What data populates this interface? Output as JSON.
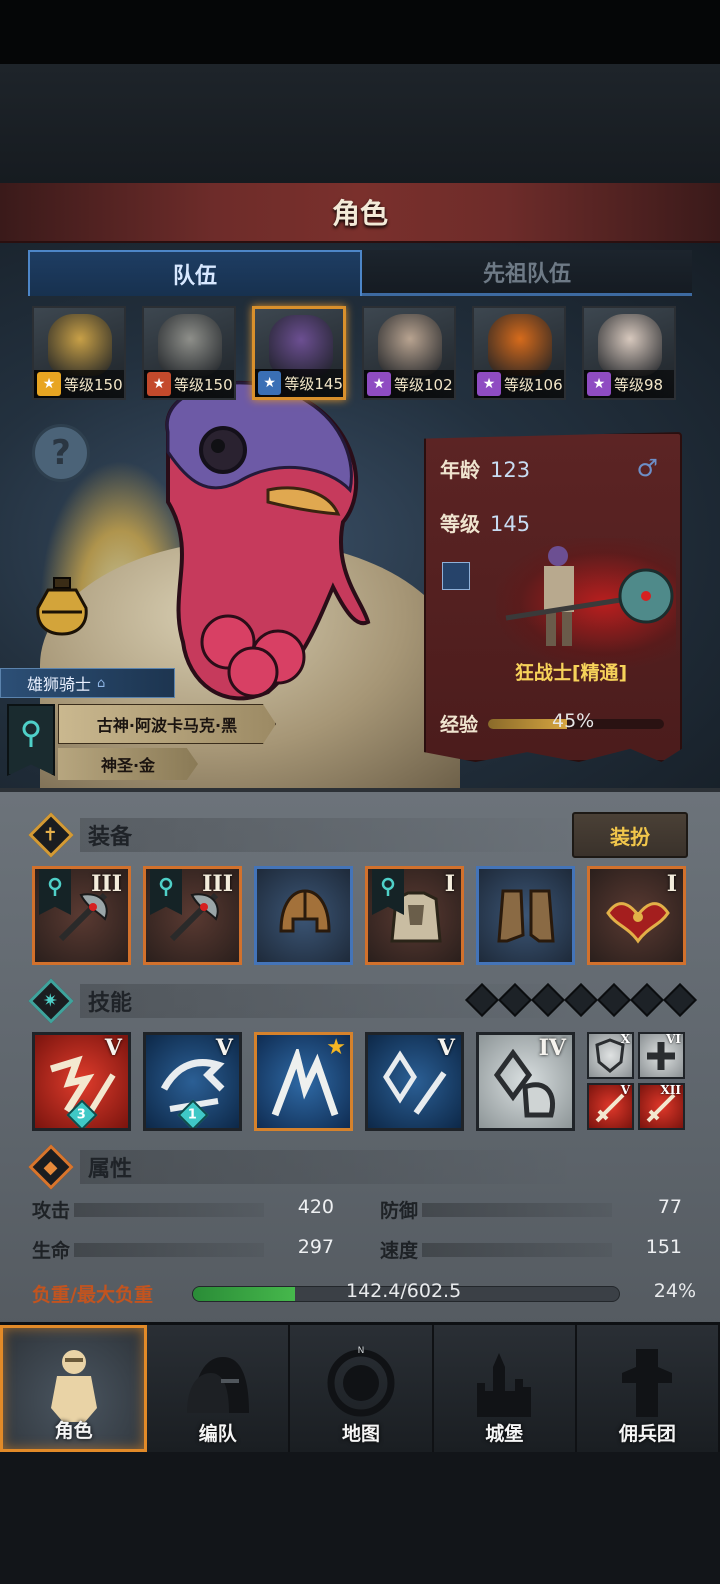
{
  "title": "角色",
  "tabs": [
    {
      "label": "队伍",
      "active": true
    },
    {
      "label": "先祖队伍",
      "active": false
    }
  ],
  "roster": [
    {
      "level_text": "等级150",
      "class_color": "#e8a522",
      "face_color": "#c8a047",
      "selected": false
    },
    {
      "level_text": "等级150",
      "class_color": "#c44a2c",
      "face_color": "#8e8f8a",
      "selected": false
    },
    {
      "level_text": "等级145",
      "class_color": "#3a6fb5",
      "face_color": "#6c4f92",
      "selected": true
    },
    {
      "level_text": "等级102",
      "class_color": "#8f4cc2",
      "face_color": "#b8a390",
      "selected": false
    },
    {
      "level_text": "等级106",
      "class_color": "#8f4cc2",
      "face_color": "#d66b1c",
      "selected": false
    },
    {
      "level_text": "等级98",
      "class_color": "#8f4cc2",
      "face_color": "#d7c8bd",
      "selected": false
    }
  ],
  "faction": {
    "order": "雄狮骑士",
    "deity": "古神·阿波卡马克·黑",
    "alignment": "神圣·金"
  },
  "hero_card": {
    "age_label": "年龄",
    "age": "123",
    "level_label": "等级",
    "level": "145",
    "class_name": "狂战士[精通]",
    "exp_label": "经验",
    "exp_percent_text": "45%",
    "exp_fraction": 0.45
  },
  "equipment": {
    "section_title": "装备",
    "dress_button": "装扮",
    "slots": [
      {
        "rarity": "orange",
        "tier": "III",
        "sigil": true,
        "item_icon": "weapon-axe-icon"
      },
      {
        "rarity": "orange",
        "tier": "III",
        "sigil": true,
        "item_icon": "weapon-axe-icon"
      },
      {
        "rarity": "blue",
        "tier": "",
        "sigil": false,
        "item_icon": "helmet-icon"
      },
      {
        "rarity": "orange",
        "tier": "I",
        "sigil": true,
        "item_icon": "armor-icon"
      },
      {
        "rarity": "blue",
        "tier": "",
        "sigil": false,
        "item_icon": "boots-icon"
      },
      {
        "rarity": "orange",
        "tier": "I",
        "sigil": false,
        "item_icon": "amulet-icon"
      }
    ]
  },
  "skills": {
    "section_title": "技能",
    "gem_slots": 7,
    "items": [
      {
        "style": "red",
        "tier": "V",
        "count": "3",
        "star": false,
        "icon": "sword-slash-icon"
      },
      {
        "style": "dblue",
        "tier": "V",
        "count": "1",
        "star": false,
        "icon": "leap-strike-icon"
      },
      {
        "style": "gold",
        "tier": "",
        "count": "",
        "star": true,
        "icon": "claw-icon"
      },
      {
        "style": "dblue",
        "tier": "V",
        "count": "",
        "star": false,
        "icon": "crystal-sword-icon"
      },
      {
        "style": "white",
        "tier": "IV",
        "count": "",
        "star": false,
        "icon": "crystal-shield-icon"
      }
    ],
    "passives": [
      {
        "style": "w",
        "tier": "X",
        "icon": "shield-icon"
      },
      {
        "style": "w",
        "tier": "VI",
        "icon": "plus-icon"
      },
      {
        "style": "r",
        "tier": "V",
        "icon": "sword-icon"
      },
      {
        "style": "r",
        "tier": "XII",
        "icon": "sword-icon"
      }
    ]
  },
  "attributes": {
    "section_title": "属性",
    "stats": [
      {
        "label": "攻击",
        "value": "420"
      },
      {
        "label": "防御",
        "value": "77"
      },
      {
        "label": "生命",
        "value": "297"
      },
      {
        "label": "速度",
        "value": "151"
      }
    ],
    "load_label": "负重/最大负重",
    "load_text": "142.4/602.5",
    "load_percent": "24%",
    "load_fraction": 0.24
  },
  "nav": [
    {
      "label": "角色",
      "icon": "knight-icon",
      "active": true
    },
    {
      "label": "编队",
      "icon": "helmet-group-icon",
      "active": false
    },
    {
      "label": "地图",
      "icon": "compass-map-icon",
      "active": false
    },
    {
      "label": "城堡",
      "icon": "castle-icon",
      "active": false
    },
    {
      "label": "佣兵团",
      "icon": "mercenary-icon",
      "active": false
    }
  ],
  "compass_north": "N",
  "colors": {
    "accent_orange": "#e28a28",
    "tab_blue": "#4d86c8",
    "gold_text": "#f6d25a",
    "load_label": "#c2541f"
  }
}
